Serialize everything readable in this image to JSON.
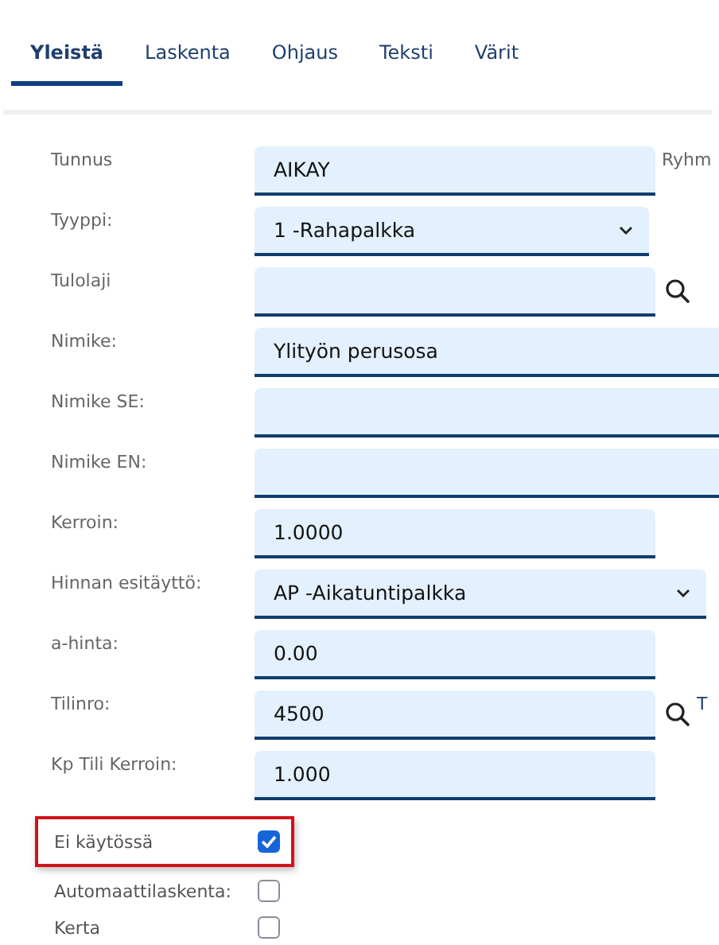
{
  "tabs": [
    {
      "label": "Yleistä",
      "selected": true
    },
    {
      "label": "Laskenta",
      "selected": false
    },
    {
      "label": "Ohjaus",
      "selected": false
    },
    {
      "label": "Teksti",
      "selected": false
    },
    {
      "label": "Värit",
      "selected": false
    }
  ],
  "fields": [
    {
      "label": "Tunnus",
      "kind": "input",
      "value": "AIKAY",
      "side_text": "Ryhm"
    },
    {
      "label": "Tyyppi:",
      "kind": "select",
      "value": "1 -Rahapalkka"
    },
    {
      "label": "Tulolaji",
      "kind": "lookup"
    },
    {
      "label": "Nimike:",
      "kind": "wide-input",
      "value": "Ylityön perusosa"
    },
    {
      "label": "Nimike SE:",
      "kind": "wide-input"
    },
    {
      "label": "Nimike EN:",
      "kind": "wide-input"
    },
    {
      "label": "Kerroin:",
      "kind": "input",
      "value": "1.0000"
    },
    {
      "label": "Hinnan esitäyttö:",
      "kind": "wide-select",
      "value": "AP -Aikatuntipalkka"
    },
    {
      "label": "a-hinta:",
      "kind": "input",
      "value": "0.00"
    },
    {
      "label": "Tilinro:",
      "kind": "lookup",
      "value": "4500",
      "side_text": "T"
    },
    {
      "label": "Kp Tili Kerroin:",
      "kind": "input",
      "value": "1.000"
    }
  ],
  "checkboxes": [
    {
      "label": "Ei käytössä",
      "checked": true,
      "highlighted": true
    },
    {
      "label": "Automaattilaskenta:",
      "checked": false,
      "highlighted": false
    },
    {
      "label": "Kerta",
      "checked": false,
      "highlighted": false
    }
  ]
}
